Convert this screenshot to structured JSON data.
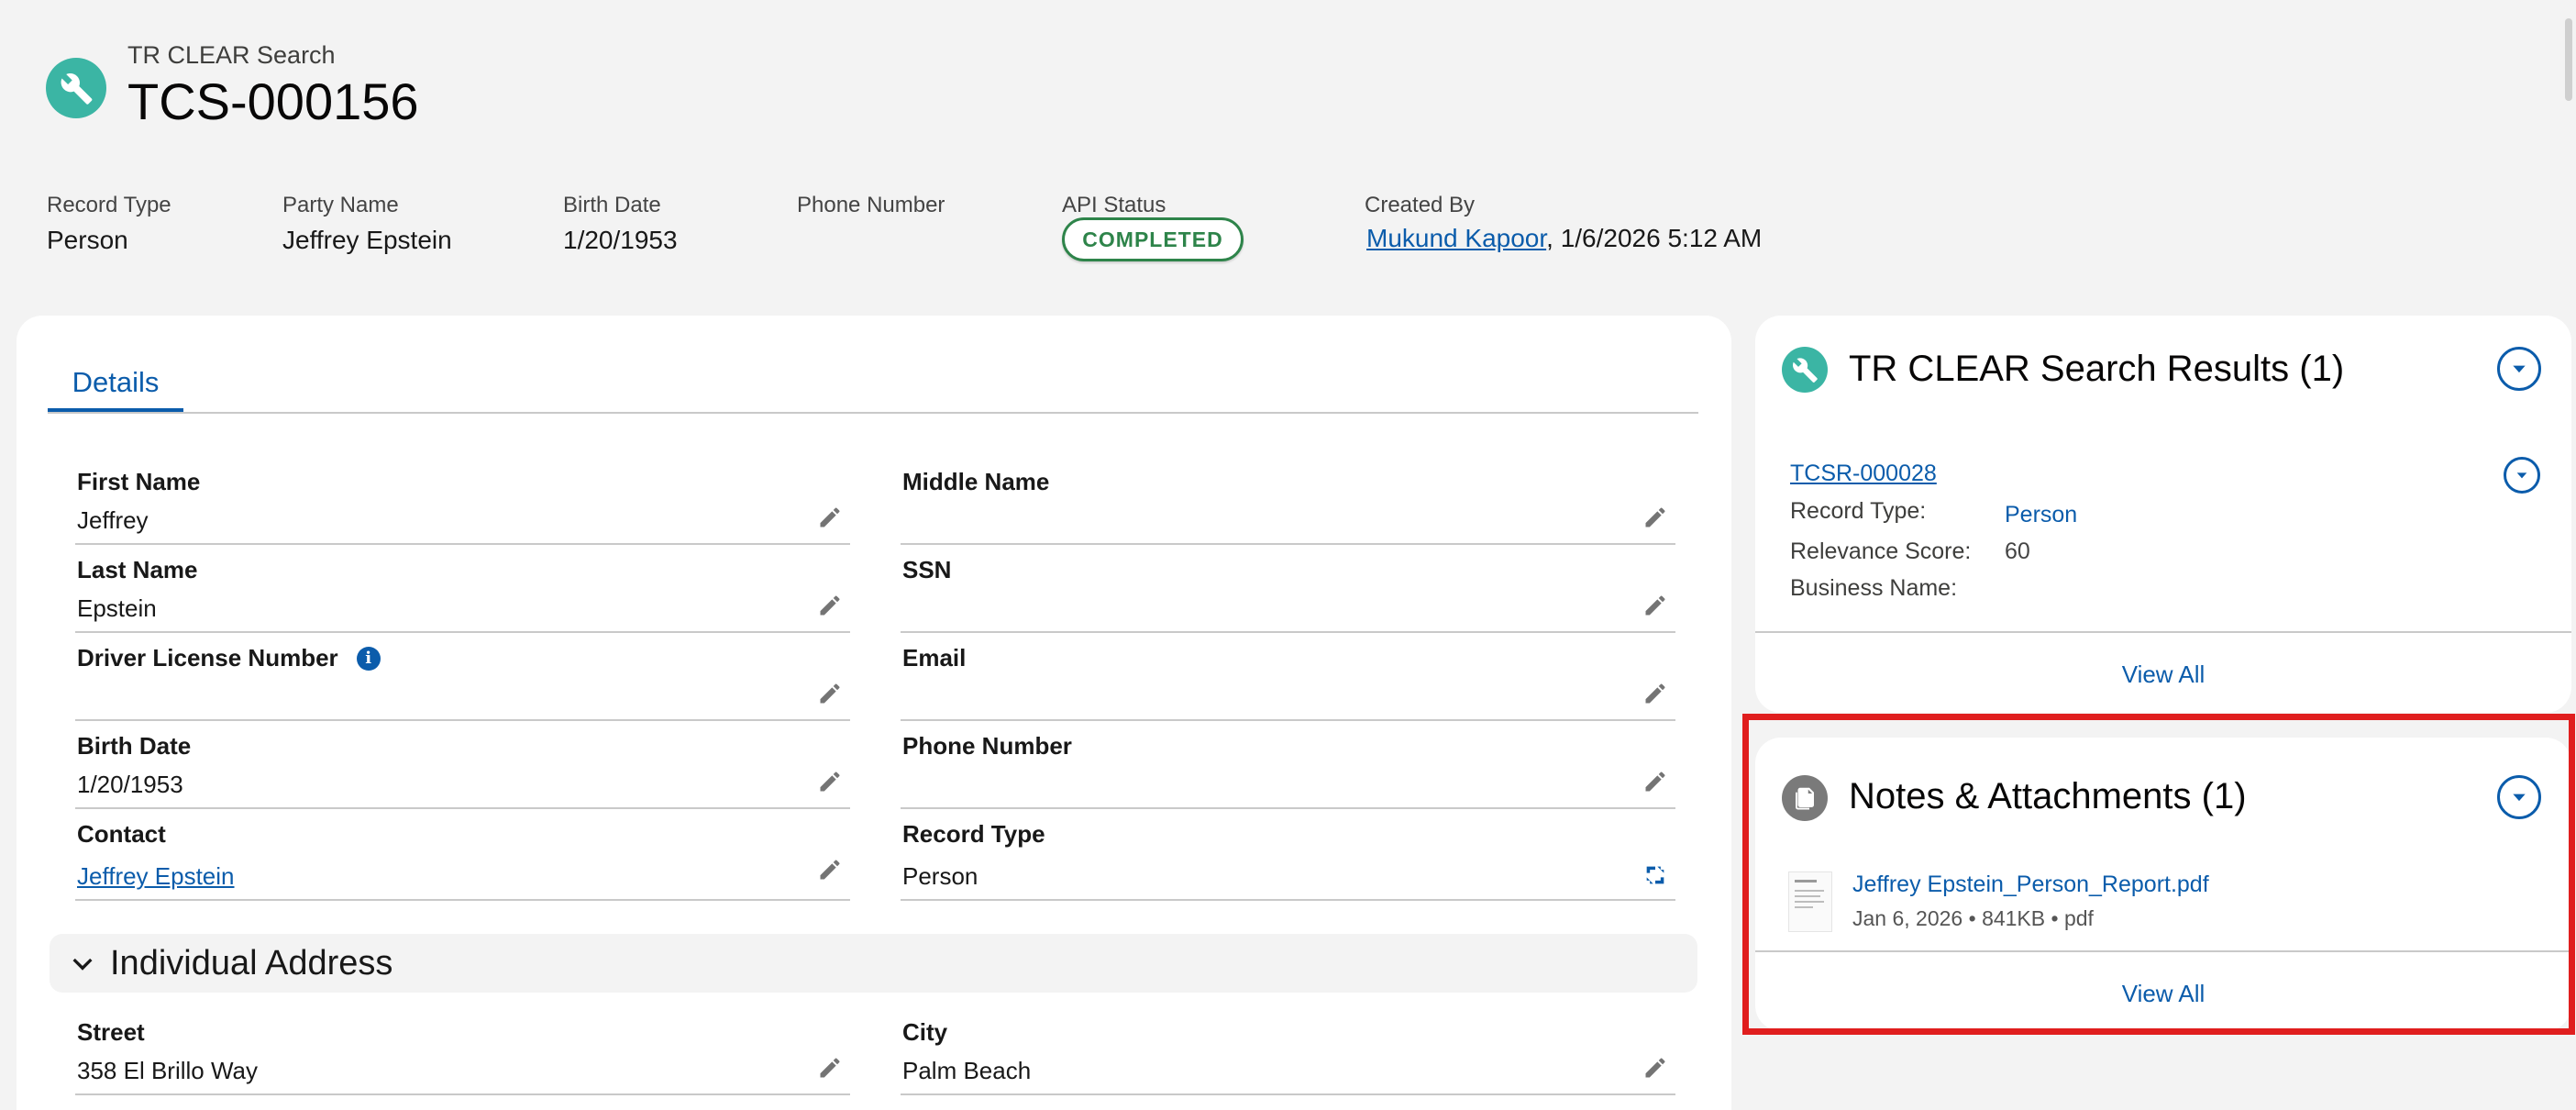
{
  "header": {
    "object_type": "TR CLEAR Search",
    "record_name": "TCS-000156",
    "icon": "wrench-icon"
  },
  "highlights": {
    "record_type": {
      "label": "Record Type",
      "value": "Person"
    },
    "party_name": {
      "label": "Party Name",
      "value": "Jeffrey Epstein"
    },
    "birth_date": {
      "label": "Birth Date",
      "value": "1/20/1953"
    },
    "phone_number": {
      "label": "Phone Number",
      "value": ""
    },
    "api_status": {
      "label": "API Status",
      "value": "COMPLETED"
    },
    "created_by": {
      "label": "Created By",
      "user": "Mukund Kapoor",
      "separator": ",",
      "datetime": "1/6/2026 5:12 AM"
    }
  },
  "details": {
    "tab_label": "Details",
    "fields": {
      "first_name": {
        "label": "First Name",
        "value": "Jeffrey"
      },
      "middle_name": {
        "label": "Middle Name",
        "value": ""
      },
      "last_name": {
        "label": "Last Name",
        "value": "Epstein"
      },
      "ssn": {
        "label": "SSN",
        "value": ""
      },
      "driver_license": {
        "label": "Driver License Number",
        "value": "",
        "info_icon": "i"
      },
      "email": {
        "label": "Email",
        "value": ""
      },
      "birth_date": {
        "label": "Birth Date",
        "value": "1/20/1953"
      },
      "phone_number": {
        "label": "Phone Number",
        "value": ""
      },
      "contact": {
        "label": "Contact",
        "value": "Jeffrey Epstein"
      },
      "record_type": {
        "label": "Record Type",
        "value": "Person"
      },
      "street": {
        "label": "Street",
        "value": "358 El Brillo Way"
      },
      "city": {
        "label": "City",
        "value": "Palm Beach"
      }
    },
    "section_individual_address": "Individual Address"
  },
  "results_card": {
    "title": "TR CLEAR Search Results (1)",
    "item": {
      "name": "TCSR-000028",
      "record_type_label": "Record Type:",
      "record_type_value": "Person",
      "relevance_label": "Relevance Score:",
      "relevance_value": "60",
      "business_label": "Business Name:",
      "business_value": ""
    },
    "view_all": "View All"
  },
  "notes_card": {
    "title": "Notes & Attachments (1)",
    "file": {
      "name": "Jeffrey Epstein_Person_Report.pdf",
      "date": "Jan 6, 2026",
      "sep1": "•",
      "size": "841KB",
      "sep2": "•",
      "ext": "pdf"
    },
    "view_all": "View All"
  },
  "colors": {
    "brand_blue": "#0b5cab",
    "status_green": "#2e844a",
    "object_icon_teal": "#3bb5a4",
    "highlight_red": "#e01e1e"
  }
}
